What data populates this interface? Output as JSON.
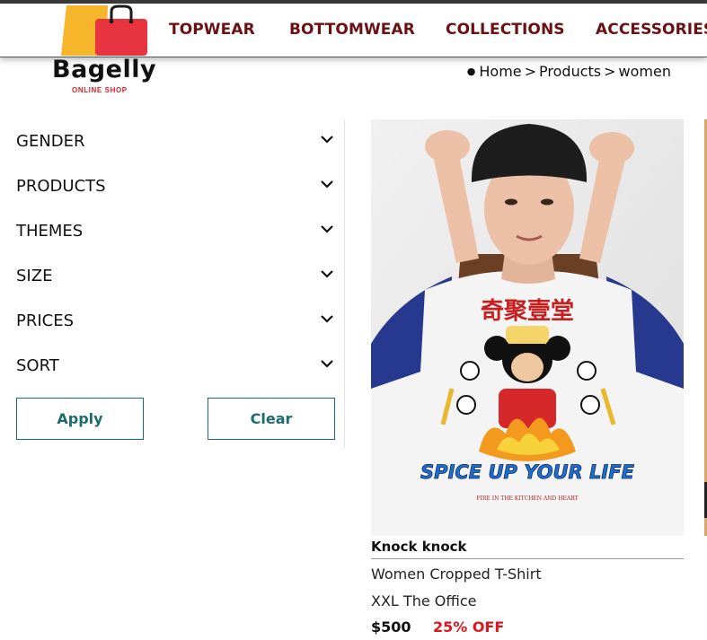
{
  "nav": {
    "links": [
      "TOPWEAR",
      "BOTTOMWEAR",
      "COLLECTIONS",
      "ACCESSORIES"
    ]
  },
  "logo": {
    "brand": "Bagelly",
    "tagline": "ONLINE SHOP",
    "icon": "shopping-bag-icon",
    "colors": {
      "back_bag": "#f7b52b",
      "front_bag": "#e8343f",
      "tagline": "#d8202a"
    }
  },
  "breadcrumb": {
    "bullet": "●",
    "items": [
      "Home",
      "Products",
      "women"
    ],
    "separator": ">"
  },
  "filters": {
    "items": [
      "GENDER",
      "PRODUCTS",
      "THEMES",
      "SIZE",
      "PRICES",
      "SORT"
    ],
    "icon": "chevron-down-icon",
    "apply_label": "Apply",
    "clear_label": "Clear"
  },
  "product": {
    "title": "Knock knock",
    "subtitle": "Women Cropped T-Shirt",
    "meta": "XXL The Office",
    "price": "$500",
    "discount": "25% OFF",
    "print_text": "SPICE UP YOUR LIFE",
    "print_subtext": "FIRE IN THE KITCHEN AND HEART"
  },
  "colors": {
    "nav_text": "#6b1010",
    "accent": "#1d6b6f",
    "discount": "#e0141e"
  }
}
